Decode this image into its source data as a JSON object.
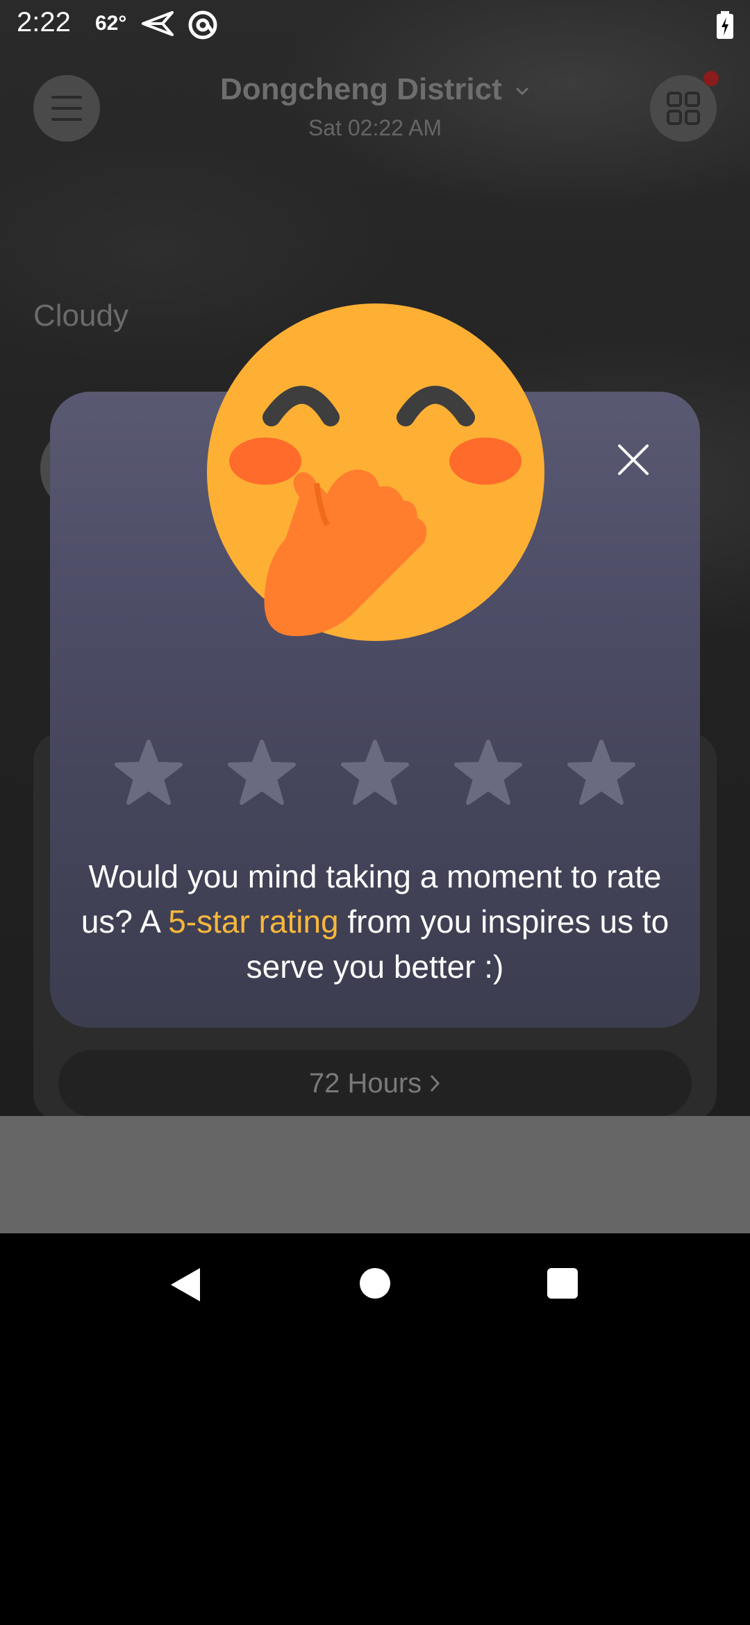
{
  "status_bar": {
    "time": "2:22",
    "temperature": "62°",
    "icons": [
      "send-icon",
      "at-sign-icon",
      "battery-charging-icon"
    ]
  },
  "header": {
    "location": "Dongcheng District",
    "datetime": "Sat 02:22 AM",
    "menu_icon": "hamburger-menu-icon",
    "apps_icon": "grid-apps-icon",
    "notification_dot_color": "#8a1c1c"
  },
  "weather": {
    "condition": "Cloudy"
  },
  "forecast": {
    "hours_button_label": "72 Hours"
  },
  "rating_dialog": {
    "text_before": "Would you mind taking a moment to rate us? A ",
    "highlight": "5-star rating",
    "text_after": " from you inspires us to serve you better :)",
    "highlight_color": "#f6b73c",
    "star_count": 5,
    "selected_stars": 0,
    "close_icon": "close-icon",
    "emoji_icon": "blushing-emoji-icon"
  },
  "nav": {
    "back_icon": "back-triangle-icon",
    "home_icon": "home-circle-icon",
    "recents_icon": "recents-square-icon"
  }
}
